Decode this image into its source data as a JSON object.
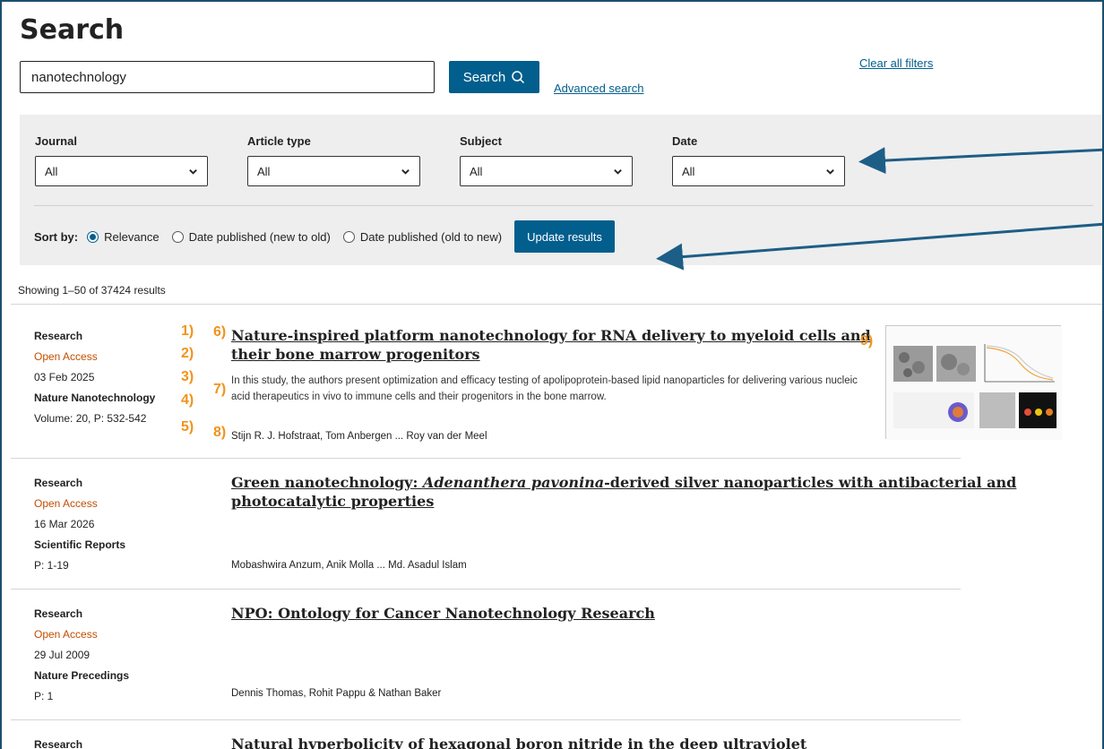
{
  "page": {
    "title": "Search"
  },
  "search": {
    "value": "nanotechnology",
    "button_label": "Search",
    "advanced_link": "Advanced search"
  },
  "filters": [
    {
      "label": "Journal",
      "value": "All"
    },
    {
      "label": "Article type",
      "value": "All"
    },
    {
      "label": "Subject",
      "value": "All"
    },
    {
      "label": "Date",
      "value": "All"
    }
  ],
  "clear_filters": "Clear all filters",
  "sort": {
    "label": "Sort by:",
    "options": [
      "Relevance",
      "Date published (new to old)",
      "Date published (old to new)"
    ],
    "selected": "Relevance",
    "update_button": "Update results"
  },
  "results_count": "Showing 1–50 of 37424 results",
  "results": [
    {
      "type": "Research",
      "access": "Open Access",
      "date": "03 Feb 2025",
      "journal": "Nature Nanotechnology",
      "volume": "Volume: 20, P: 532-542",
      "title": "Nature-inspired platform nanotechnology for RNA delivery to myeloid cells and their bone marrow progenitors",
      "snippet": "In this study, the authors present optimization and efficacy testing of apolipoprotein-based lipid nanoparticles for delivering various nucleic acid therapeutics in vivo to immune cells and their progenitors in the bone marrow.",
      "authors": "Stijn R. J. Hofstraat, Tom Anbergen ... Roy van der Meel"
    },
    {
      "type": "Research",
      "access": "Open Access",
      "date": "16 Mar 2026",
      "journal": "Scientific Reports",
      "volume": "P: 1-19",
      "title_prefix": "Green nanotechnology: ",
      "title_italic": "Adenanthera pavonina",
      "title_suffix": "-derived silver nanoparticles with antibacterial and photocatalytic properties",
      "authors": "Mobashwira Anzum, Anik Molla ... Md. Asadul Islam"
    },
    {
      "type": "Research",
      "access": "Open Access",
      "date": "29 Jul 2009",
      "journal": "Nature Precedings",
      "volume": "P: 1",
      "title": "NPO: Ontology for Cancer Nanotechnology Research",
      "authors": "Dennis Thomas, Rohit Pappu & Nathan Baker"
    },
    {
      "type": "Research",
      "title": "Natural hyperbolicity of hexagonal boron nitride in the deep ultraviolet"
    }
  ],
  "annotations": [
    "1)",
    "2)",
    "3)",
    "4)",
    "5)",
    "6)",
    "7)",
    "8)",
    "9)"
  ],
  "colors": {
    "accent": "#025e8d",
    "open_access": "#c24e00",
    "annotation": "#f0931c",
    "panel": "#eeeeee"
  },
  "icons": {
    "search": "magnifier-icon",
    "select": "chevron-down-icon"
  }
}
